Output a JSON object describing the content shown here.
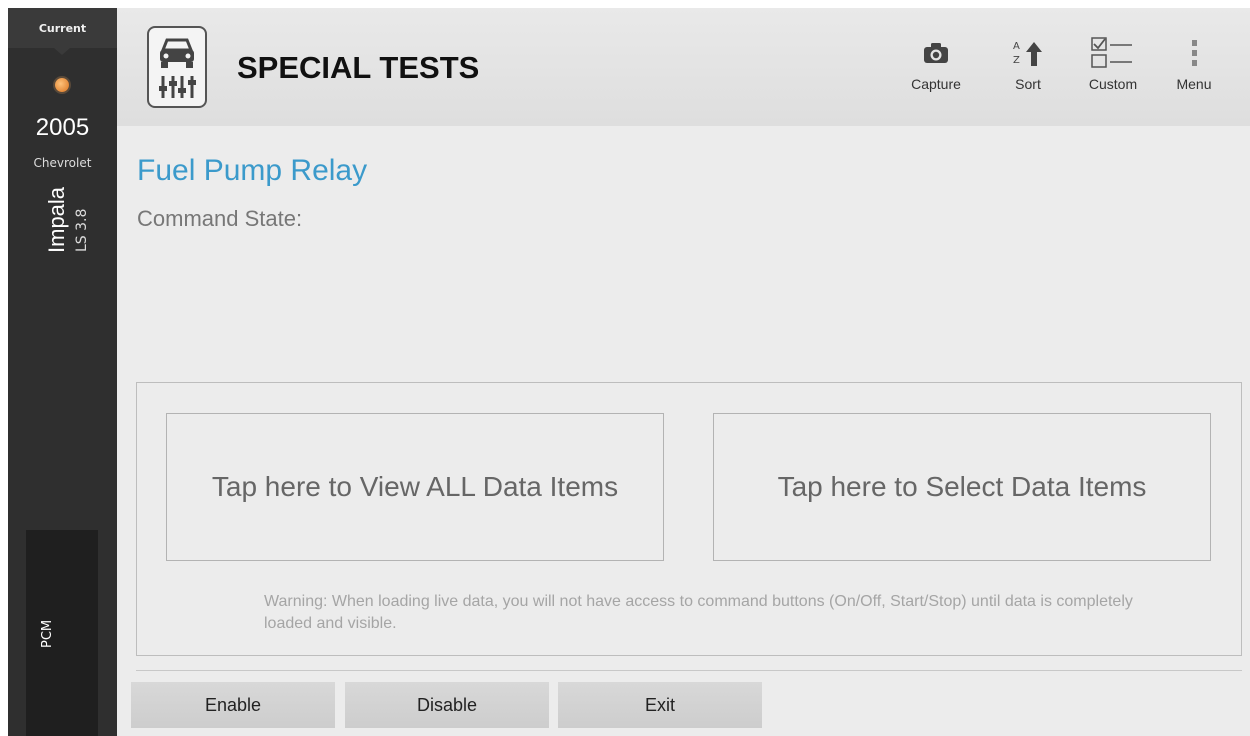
{
  "sidebar": {
    "current_label": "Current",
    "year": "2005",
    "make": "Chevrolet",
    "model": "Impala",
    "trim": "LS 3.8",
    "module": "PCM",
    "status_color": "#e07a24"
  },
  "header": {
    "title": "SPECIAL TESTS",
    "app_icon": "car-sliders-icon",
    "tools": [
      {
        "label": "Capture",
        "icon": "camera-icon"
      },
      {
        "label": "Sort",
        "icon": "sort-az-icon"
      },
      {
        "label": "Custom",
        "icon": "checklist-icon"
      },
      {
        "label": "Menu",
        "icon": "vertical-dots-icon"
      }
    ]
  },
  "main": {
    "test_name": "Fuel Pump Relay",
    "command_state_label": "Command State:",
    "view_all_label": "Tap here to View ALL Data Items",
    "select_label": "Tap here to Select Data Items",
    "warning": "Warning: When loading live data, you will not have access to command buttons (On/Off, Start/Stop) until data is completely loaded and visible.",
    "accent_color": "#3b9acb"
  },
  "footer": {
    "enable_label": "Enable",
    "disable_label": "Disable",
    "exit_label": "Exit"
  }
}
